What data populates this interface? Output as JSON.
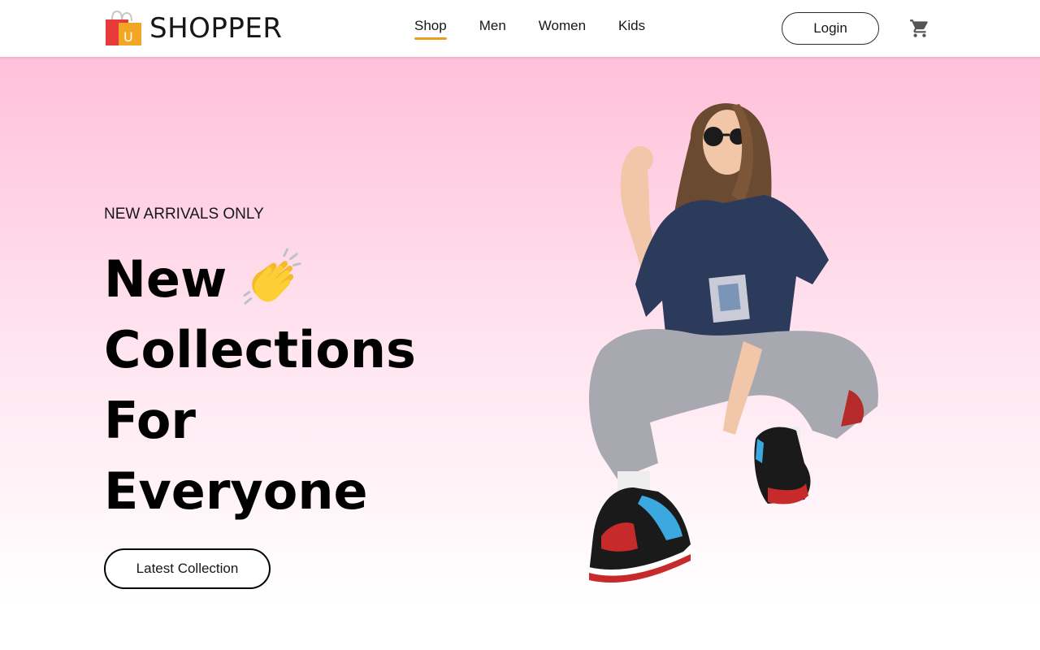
{
  "brand": {
    "name": "SHOPPER",
    "logo_icon": "shopping-bags-icon",
    "logo_letter": "U"
  },
  "nav": {
    "items": [
      {
        "label": "Shop",
        "active": true
      },
      {
        "label": "Men",
        "active": false
      },
      {
        "label": "Women",
        "active": false
      },
      {
        "label": "Kids",
        "active": false
      }
    ],
    "login_label": "Login",
    "cart_icon": "cart-icon"
  },
  "hero": {
    "tag": "NEW ARRIVALS ONLY",
    "title_lines": [
      "New",
      "Collections",
      "For",
      "Everyone"
    ],
    "title_emoji": "clapping-hands-icon",
    "cta_label": "Latest Collection",
    "image": "model-photo"
  },
  "colors": {
    "accent": "#e8a020",
    "hero_gradient_top": "#ffc0d9",
    "hero_gradient_bottom": "#ffffff",
    "text": "#171717"
  }
}
